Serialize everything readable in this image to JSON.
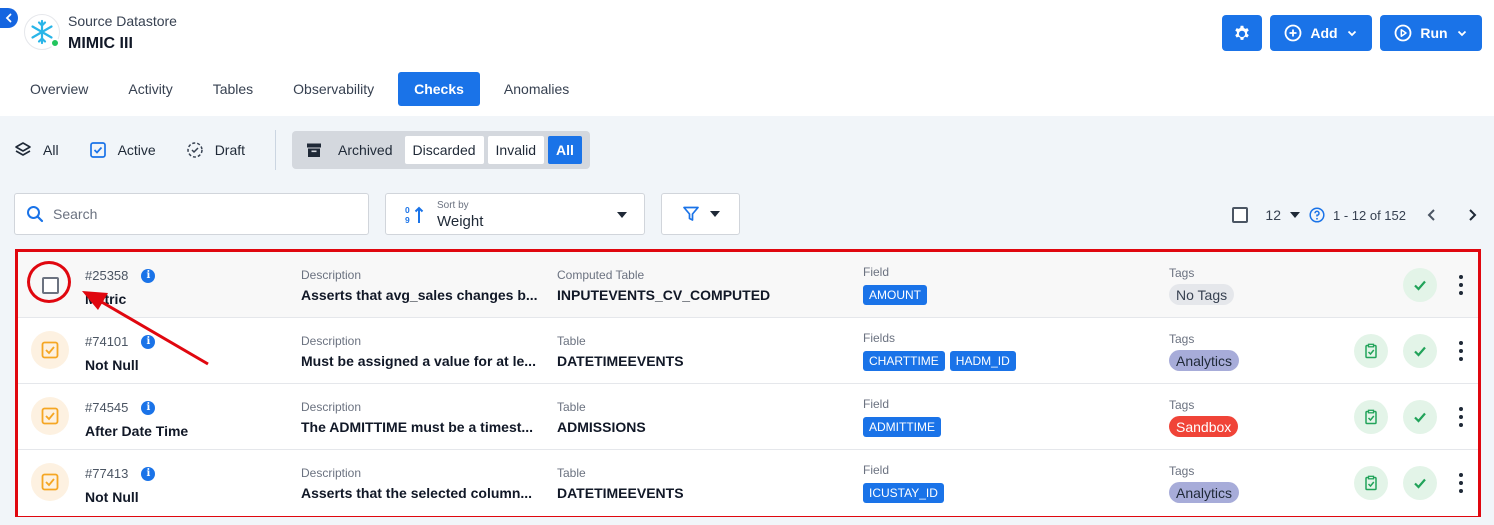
{
  "header": {
    "datastore_label": "Source Datastore",
    "datastore_name": "MIMIC III",
    "add_label": "Add",
    "run_label": "Run"
  },
  "tabs": [
    {
      "label": "Overview",
      "active": false
    },
    {
      "label": "Activity",
      "active": false
    },
    {
      "label": "Tables",
      "active": false
    },
    {
      "label": "Observability",
      "active": false
    },
    {
      "label": "Checks",
      "active": true
    },
    {
      "label": "Anomalies",
      "active": false
    }
  ],
  "status_filters": {
    "all": "All",
    "active": "Active",
    "draft": "Draft",
    "archived": "Archived",
    "discarded": "Discarded",
    "invalid": "Invalid",
    "archived_all": "All"
  },
  "toolbar": {
    "search_placeholder": "Search",
    "sort_caption": "Sort by",
    "sort_value": "Weight"
  },
  "pagination": {
    "page_size": "12",
    "range_text": "1 - 12 of 152"
  },
  "checks": [
    {
      "id": "#25358",
      "type": "Metric",
      "desc_label": "Description",
      "description": "Asserts that avg_sales changes b...",
      "table_label": "Computed Table",
      "table": "INPUTEVENTS_CV_COMPUTED",
      "field_label": "Field",
      "fields": [
        "AMOUNT"
      ],
      "tags_label": "Tags",
      "tag": "No Tags",
      "tag_color": "#e5e7eb",
      "tag_text_color": "#374151"
    },
    {
      "id": "#74101",
      "type": "Not Null",
      "desc_label": "Description",
      "description": "Must be assigned a value for at le...",
      "table_label": "Table",
      "table": "DATETIMEEVENTS",
      "field_label": "Fields",
      "fields": [
        "CHARTTIME",
        "HADM_ID"
      ],
      "tags_label": "Tags",
      "tag": "Analytics",
      "tag_color": "#a7acd9",
      "tag_text_color": "#1f2937"
    },
    {
      "id": "#74545",
      "type": "After Date Time",
      "desc_label": "Description",
      "description": "The ADMITTIME must be a timest...",
      "table_label": "Table",
      "table": "ADMISSIONS",
      "field_label": "Field",
      "fields": [
        "ADMITTIME"
      ],
      "tags_label": "Tags",
      "tag": "Sandbox",
      "tag_color": "#f04438",
      "tag_text_color": "#ffffff"
    },
    {
      "id": "#77413",
      "type": "Not Null",
      "desc_label": "Description",
      "description": "Asserts that the selected column...",
      "table_label": "Table",
      "table": "DATETIMEEVENTS",
      "field_label": "Field",
      "fields": [
        "ICUSTAY_ID"
      ],
      "tags_label": "Tags",
      "tag": "Analytics",
      "tag_color": "#a7acd9",
      "tag_text_color": "#1f2937"
    }
  ],
  "colors": {
    "primary": "#1a73e8",
    "highlight": "#e0070f",
    "success": "#22a35a",
    "draft_orange": "#f5a623"
  }
}
